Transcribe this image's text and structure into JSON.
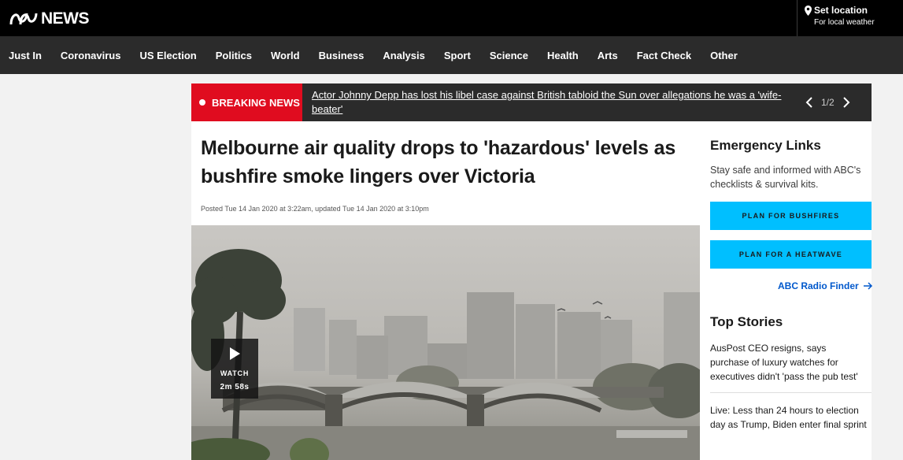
{
  "header": {
    "logo_text": "NEWS",
    "set_location": "Set location",
    "local_weather": "For local weather",
    "icons": {
      "logo": "abc-logo-icon",
      "location": "location-pin-icon"
    }
  },
  "nav": {
    "items": [
      "Just In",
      "Coronavirus",
      "US Election",
      "Politics",
      "World",
      "Business",
      "Analysis",
      "Sport",
      "Science",
      "Health",
      "Arts",
      "Fact Check",
      "Other"
    ]
  },
  "breaking": {
    "label": "BREAKING NEWS",
    "headline": "Actor Johnny Depp has lost his libel case against British tabloid the Sun over allegations he was a 'wife-beater'",
    "count": "1/2",
    "icons": {
      "prev": "chevron-left-icon",
      "next": "chevron-right-icon"
    }
  },
  "article": {
    "title": "Melbourne air quality drops to 'hazardous' levels as bushfire smoke lingers over Victoria",
    "meta": "Posted Tue 14 Jan 2020 at 3:22am, updated Tue 14 Jan 2020 at 3:10pm",
    "video": {
      "label": "WATCH",
      "duration": "2m 58s",
      "icon": "play-icon"
    }
  },
  "sidebar": {
    "emergency_title": "Emergency Links",
    "emergency_desc": "Stay safe and informed with ABC's checklists & survival kits.",
    "btn_bushfires": "PLAN FOR BUSHFIRES",
    "btn_heatwave": "PLAN FOR A HEATWAVE",
    "radio_finder": "ABC Radio Finder",
    "top_stories_title": "Top Stories",
    "stories": [
      "AusPost CEO resigns, says purchase of luxury watches for executives didn't 'pass the pub test'",
      "Live: Less than 24 hours to election day as Trump, Biden enter final sprint"
    ],
    "colors": {
      "button": "#00bfff",
      "link": "#0058cc",
      "breaking": "#e00c1f"
    }
  }
}
